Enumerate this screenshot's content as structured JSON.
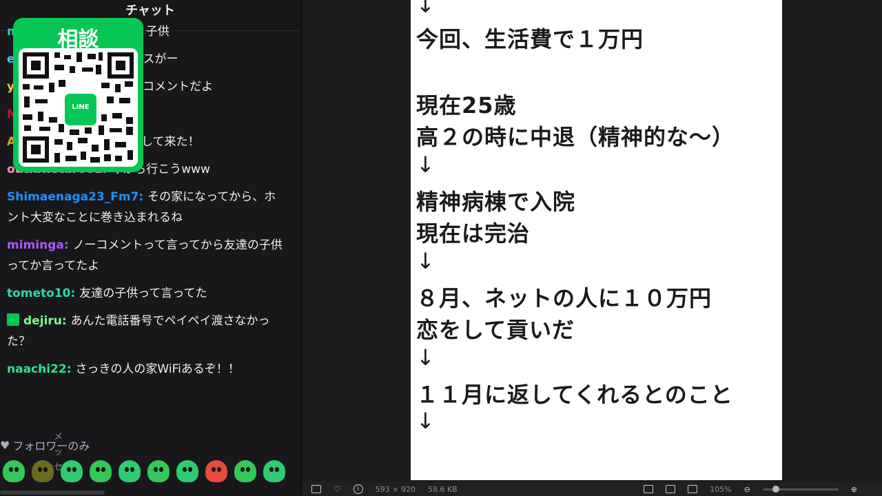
{
  "chat": {
    "header_title": "チャット",
    "messages": [
      {
        "user": "outlawstar001",
        "color": "#ff8fb1",
        "text": "今から行こうwww"
      },
      {
        "user": "Shimaenaga23_Fm7",
        "color": "#1e90ff",
        "text": "その家になってから、ホント大変なことに巻き込まれるね"
      },
      {
        "user": "miminga",
        "color": "#b157ff",
        "text": "ノーコメントって言ってから友達の子供ってか言ってたよ"
      },
      {
        "user": "tometo10",
        "color": "#2fd6b0",
        "text": "友達の子供って言ってた"
      },
      {
        "user": "dejiru",
        "color": "#7cfc8a",
        "text": "あんた電話番号でペイペイ渡さなかった？",
        "badge": "gift-icon"
      },
      {
        "user": "naachi22",
        "color": "#2fe38a",
        "text": "さっきの人の家WiFiあるぞ！！"
      }
    ],
    "partial_lines": [
      {
        "prefix": "m",
        "prefix_color": "#2fd6b0",
        "text": "子供"
      },
      {
        "prefix": "e",
        "prefix_color": "#3ecfff",
        "text": "スがー"
      },
      {
        "prefix": "y",
        "prefix_color": "#f5c542",
        "text": "コメントだよ"
      },
      {
        "prefix": "N",
        "prefix_color": "#c4172c",
        "text": ""
      },
      {
        "prefix": "A",
        "prefix_color": "#e0a020",
        "text": "して来た！"
      }
    ],
    "follower_only_label": "フォロワーのみ",
    "vertical_text": "メッセ"
  },
  "qr_overlay": {
    "title": "相談",
    "badge_label": "LINE"
  },
  "document": {
    "lines": [
      "↓",
      "今回、生活費で１万円",
      "",
      "現在25歳",
      "高２の時に中退（精神的な〜）",
      "↓",
      "精神病棟で入院",
      "現在は完治",
      "↓",
      "８月、ネットの人に１０万円",
      "恋をして貢いだ",
      "↓",
      "１１月に返してくれるとのこと",
      "↓"
    ]
  },
  "toolbar": {
    "dimensions": "593 × 920",
    "file_size": "58.6 KB",
    "zoom": "105%"
  },
  "colors": {
    "chat_bg": "#18181b",
    "line_green": "#06c755"
  }
}
